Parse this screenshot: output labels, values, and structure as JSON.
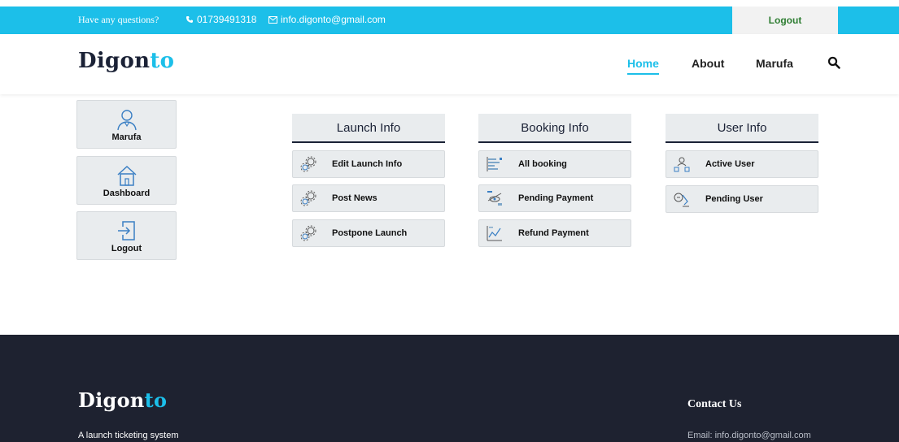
{
  "topbar": {
    "question": "Have any questions?",
    "phone": "01739491318",
    "email": "info.digonto@gmail.com",
    "logout": "Logout"
  },
  "header": {
    "brand_main": "Digon",
    "brand_accent": "to",
    "nav": {
      "home": "Home",
      "about": "About",
      "user": "Marufa"
    }
  },
  "sidebar": {
    "profile": "Marufa",
    "dashboard": "Dashboard",
    "logout": "Logout"
  },
  "launch_info": {
    "title": "Launch Info",
    "items": [
      "Edit Launch Info",
      "Post News",
      "Postpone Launch"
    ]
  },
  "booking_info": {
    "title": "Booking Info",
    "items": [
      "All booking",
      "Pending Payment",
      "Refund Payment"
    ]
  },
  "user_info": {
    "title": "User Info",
    "items": [
      "Active User",
      "Pending User"
    ]
  },
  "footer": {
    "brand_main": "Digon",
    "brand_accent": "to",
    "tagline": "A launch ticketing system",
    "contact_title": "Contact Us",
    "contact_email": "Email: info.digonto@gmail.com"
  },
  "colors": {
    "accent": "#1cbfe9",
    "dark": "#1e2230",
    "panel": "#e9ecee"
  }
}
